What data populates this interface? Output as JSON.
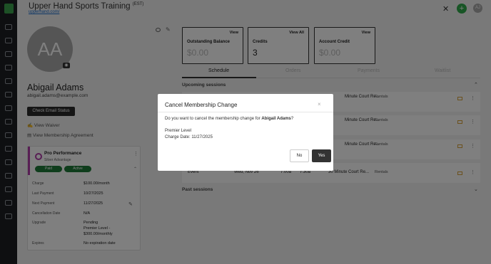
{
  "header": {
    "title": "Upper Hand Sports Training",
    "timezone": "(EST)",
    "subtitle": "upperhand.com/",
    "avatar_initials": "AJ"
  },
  "profile": {
    "initials": "AA",
    "name": "Abigail Adams",
    "email": "abigail.adams@example.com",
    "check_email_label": "Check Email Status",
    "view_waiver": "View Waiver",
    "view_agreement": "View Membership Agreement"
  },
  "membership": {
    "title": "Pro Performance",
    "subtitle": "Silver Advantage",
    "paid_pill": "Paid",
    "active_pill": "Active",
    "charge_label": "Charge",
    "charge": "$100.00/month",
    "last_payment_label": "Last Payment",
    "last_payment": "10/27/2025",
    "next_payment_label": "Next Payment",
    "next_payment": "11/27/2025",
    "cancellation_label": "Cancellation Date",
    "cancellation": "N/A",
    "upgrade_label": "Upgrade",
    "upgrade_line1": "Pending",
    "upgrade_line2": "Premier Level -",
    "upgrade_line3": "$300.00/monthly",
    "expires_label": "Expires",
    "expires": "No expiration date"
  },
  "panels": [
    {
      "title": "Outstanding Balance",
      "button": "View",
      "value": "$0.00"
    },
    {
      "title": "Credits",
      "button": "View All",
      "value": "3"
    },
    {
      "title": "Account Credit",
      "button": "View",
      "value": "$0.00"
    }
  ],
  "tabs": [
    "Schedule",
    "Orders",
    "Payments",
    "Waitlist"
  ],
  "sections": {
    "upcoming": "Upcoming sessions",
    "past": "Past sessions"
  },
  "sessions": [
    {
      "title": "Minute Court Re...",
      "type": "Rentals"
    },
    {
      "title": "Minute Court Re...",
      "type": "Rentals"
    },
    {
      "title": "Minute Court Re...",
      "type": "Rentals"
    },
    {
      "col1": "Event",
      "col2": "Wed, Nov 26",
      "col3": "7:00a",
      "col4": "7:30a",
      "title": "30 Minute Court Re...",
      "type": "Rentals"
    }
  ],
  "modal": {
    "title": "Cancel Membership Change",
    "question_prefix": "Do you want to cancel the membership change for ",
    "question_name": "Abigail Adams",
    "question_suffix": "?",
    "level": "Premier Level",
    "charge_date": "Charge Date: 11/27/2025",
    "no_label": "No",
    "yes_label": "Yes",
    "close_glyph": "×"
  }
}
